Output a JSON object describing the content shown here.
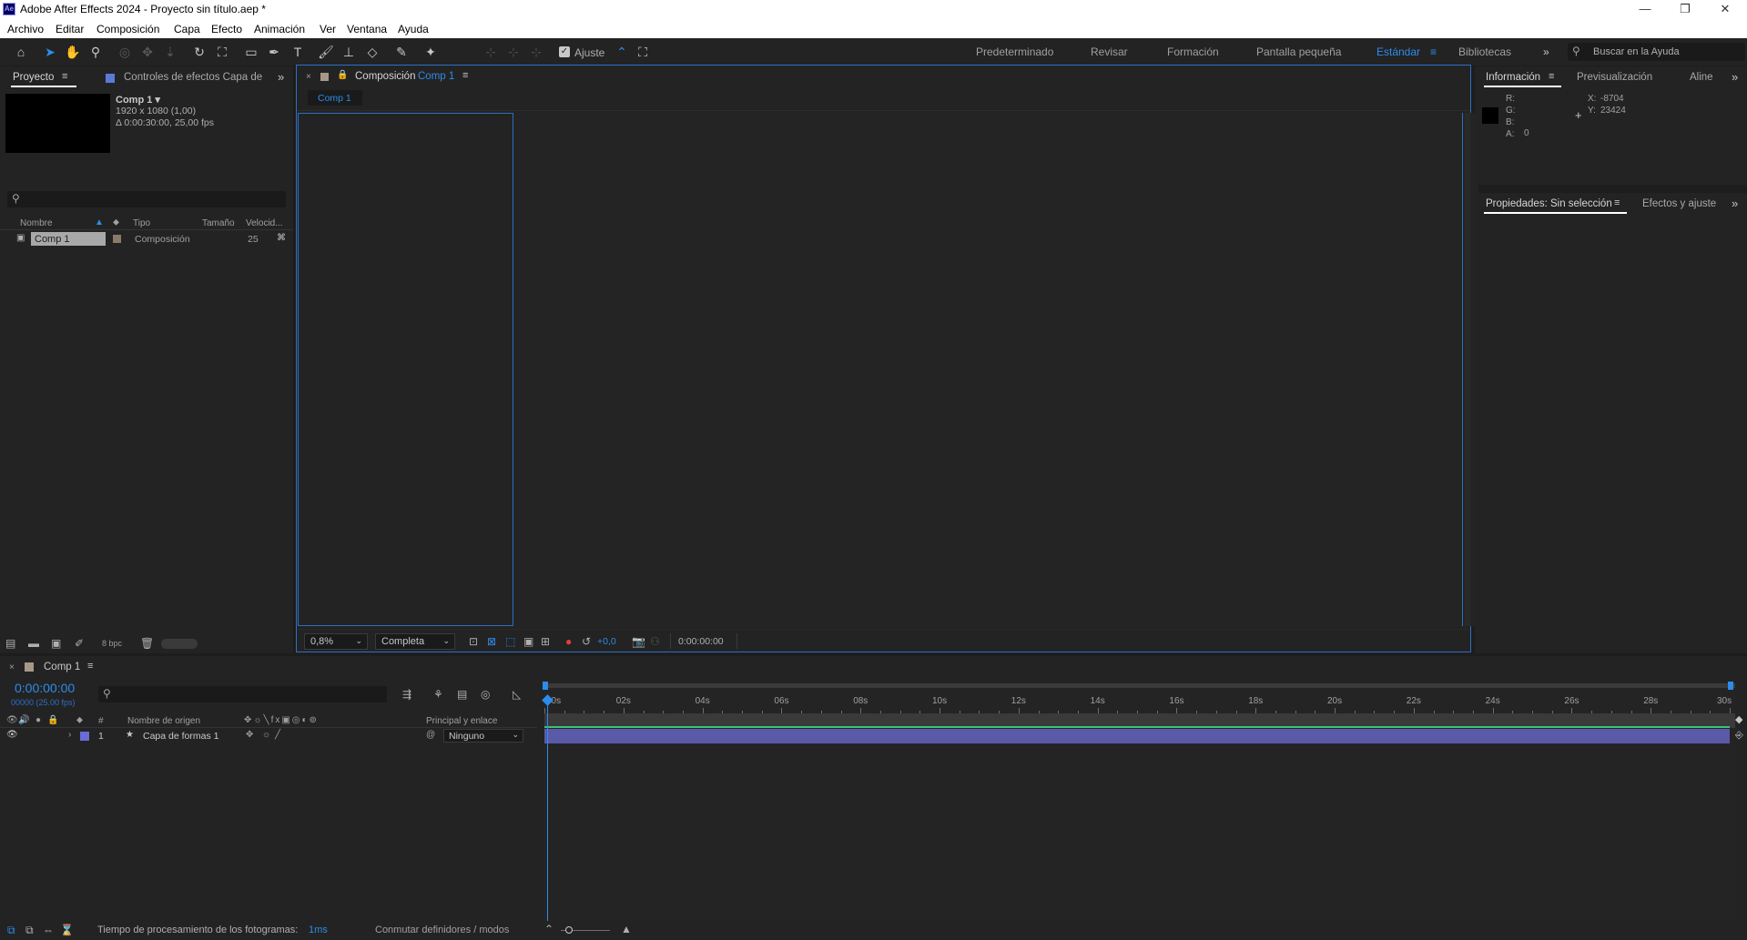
{
  "window": {
    "app_icon": "Ae",
    "title": "Adobe After Effects 2024 - Proyecto sin título.aep *",
    "minimize_icon": "minimize-icon",
    "restore_icon": "restore-icon",
    "close_icon": "close-icon"
  },
  "menu": [
    "Archivo",
    "Editar",
    "Composición",
    "Capa",
    "Efecto",
    "Animación",
    "Ver",
    "Ventana",
    "Ayuda"
  ],
  "toolbar": {
    "snap_label": "Ajuste",
    "workspaces": [
      "Predeterminado",
      "Revisar",
      "Formación",
      "Pantalla pequeña",
      "Estándar",
      "Bibliotecas"
    ],
    "active_workspace": "Estándar",
    "search_placeholder": "Buscar en la Ayuda"
  },
  "project_panel": {
    "tab_project": "Proyecto",
    "tab_effects": "Controles de efectos Capa de",
    "comp_name": "Comp 1 ▾",
    "comp_size": "1920 x 1080 (1,00)",
    "comp_duration": "Δ 0:00:30:00, 25,00 fps",
    "columns": [
      "Nombre",
      "Tipo",
      "Tamaño",
      "Velocid..."
    ],
    "items": [
      {
        "name": "Comp 1",
        "type": "Composición",
        "fps": "25"
      }
    ],
    "bit_depth": "8 bpc"
  },
  "comp_panel": {
    "tab_label": "Composición",
    "tab_comp": "Comp 1",
    "viewer_tab": "Comp 1",
    "zoom": "0,8%",
    "resolution": "Completa",
    "exposure": "+0,0",
    "timecode": "0:00:00:00"
  },
  "info_panel": {
    "tab_info": "Información",
    "tab_preview": "Previsualización",
    "tab_align": "Aline",
    "r_label": "R:",
    "g_label": "G:",
    "b_label": "B:",
    "a_label": "A:",
    "a_value": "0",
    "x_label": "X:",
    "x_value": "-8704",
    "y_label": "Y:",
    "y_value": "23424"
  },
  "properties_panel": {
    "tab_props": "Propiedades: Sin selección",
    "tab_effects": "Efectos y ajuste"
  },
  "timeline": {
    "tab_label": "Comp 1",
    "timecode": "0:00:00:00",
    "frame_info": "00000 (25.00 fps)",
    "col_source": "Nombre de origen",
    "col_parent": "Principal y enlace",
    "col_number": "#",
    "layers": [
      {
        "index": "1",
        "name": "Capa de formas 1",
        "parent": "Ninguno",
        "color": "#6b6bd6"
      }
    ],
    "ruler": [
      "00s",
      "02s",
      "04s",
      "06s",
      "08s",
      "10s",
      "12s",
      "14s",
      "16s",
      "18s",
      "20s",
      "22s",
      "24s",
      "26s",
      "28s",
      "30s"
    ],
    "status_label": "Tiempo de procesamiento de los fotogramas:",
    "status_value": "1ms",
    "toggle_label": "Conmutar definidores / modos"
  },
  "colors": {
    "accent": "#2d8ceb",
    "layer_bar": "#5a5aa8",
    "work_area": "#3a3a3a"
  }
}
